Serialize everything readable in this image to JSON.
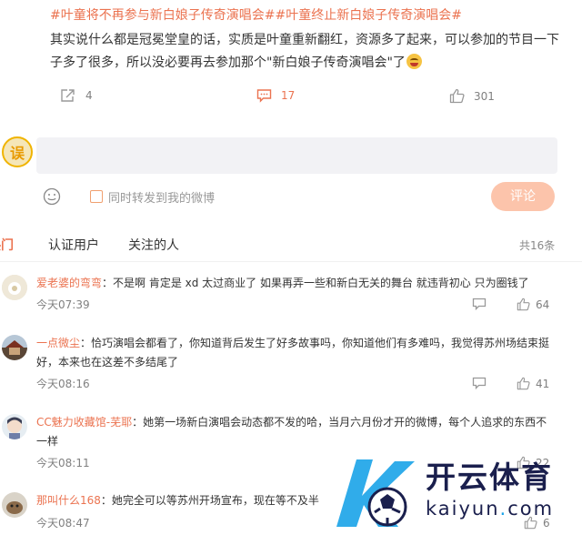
{
  "post": {
    "hashtags": "#叶童将不再参与新白娘子传奇演唱会##叶童终止新白娘子传奇演唱会#",
    "text": "其实说什么都是冠冕堂皇的话，实质是叶童重新翻红，资源多了起来，可以参加的节目一下子多了很多，所以没必要再去参加那个\"新白娘子传奇演唱会\"了",
    "emoji_icon": "laughing-tears-emoji",
    "actions": {
      "repost_count": "4",
      "comment_count": "17",
      "like_count": "301"
    }
  },
  "composer": {
    "avatar_text": "误",
    "placeholder": "",
    "repost_label": "同时转发到我的微博",
    "submit_label": "评论"
  },
  "tabs": [
    {
      "label": "热门"
    },
    {
      "label": "认证用户"
    },
    {
      "label": "关注的人"
    }
  ],
  "total_label": "共16条",
  "comments": [
    {
      "user": "爱老婆的弯弯",
      "text": "：不是啊 肯定是 xd 太过商业了 如果再弄一些和新白无关的舞台 就违背初心 只为圈钱了",
      "time": "今天07:39",
      "likes": "64"
    },
    {
      "user": "一点微尘",
      "text": "：恰巧演唱会都看了，你知道背后发生了好多故事吗，你知道他们有多难吗，我觉得苏州场结束挺好，本来也在这差不多结尾了",
      "time": "今天08:16",
      "likes": "41"
    },
    {
      "user": "CC魅力收藏馆-芜耶",
      "text": "：她第一场新白演唱会动态都不发的哈，当月六月份才开的微博，每个人追求的东西不一样",
      "time": "今天08:11",
      "likes": "22"
    },
    {
      "user": "那叫什么168",
      "text": "：她完全可以等苏州开场宣布，现在等不及半",
      "time": "今天08:47",
      "likes": "6"
    }
  ],
  "watermark": {
    "brand": "开云体育",
    "url_prefix": "kaiyun",
    "url_dot": ".",
    "url_suffix": "com"
  },
  "colors": {
    "accent": "#eb7350",
    "submit_bg": "#fcc4ab",
    "input_bg": "#f2f2f5",
    "watermark_text": "#1a1f4d",
    "watermark_blue": "#1aa3e8"
  }
}
